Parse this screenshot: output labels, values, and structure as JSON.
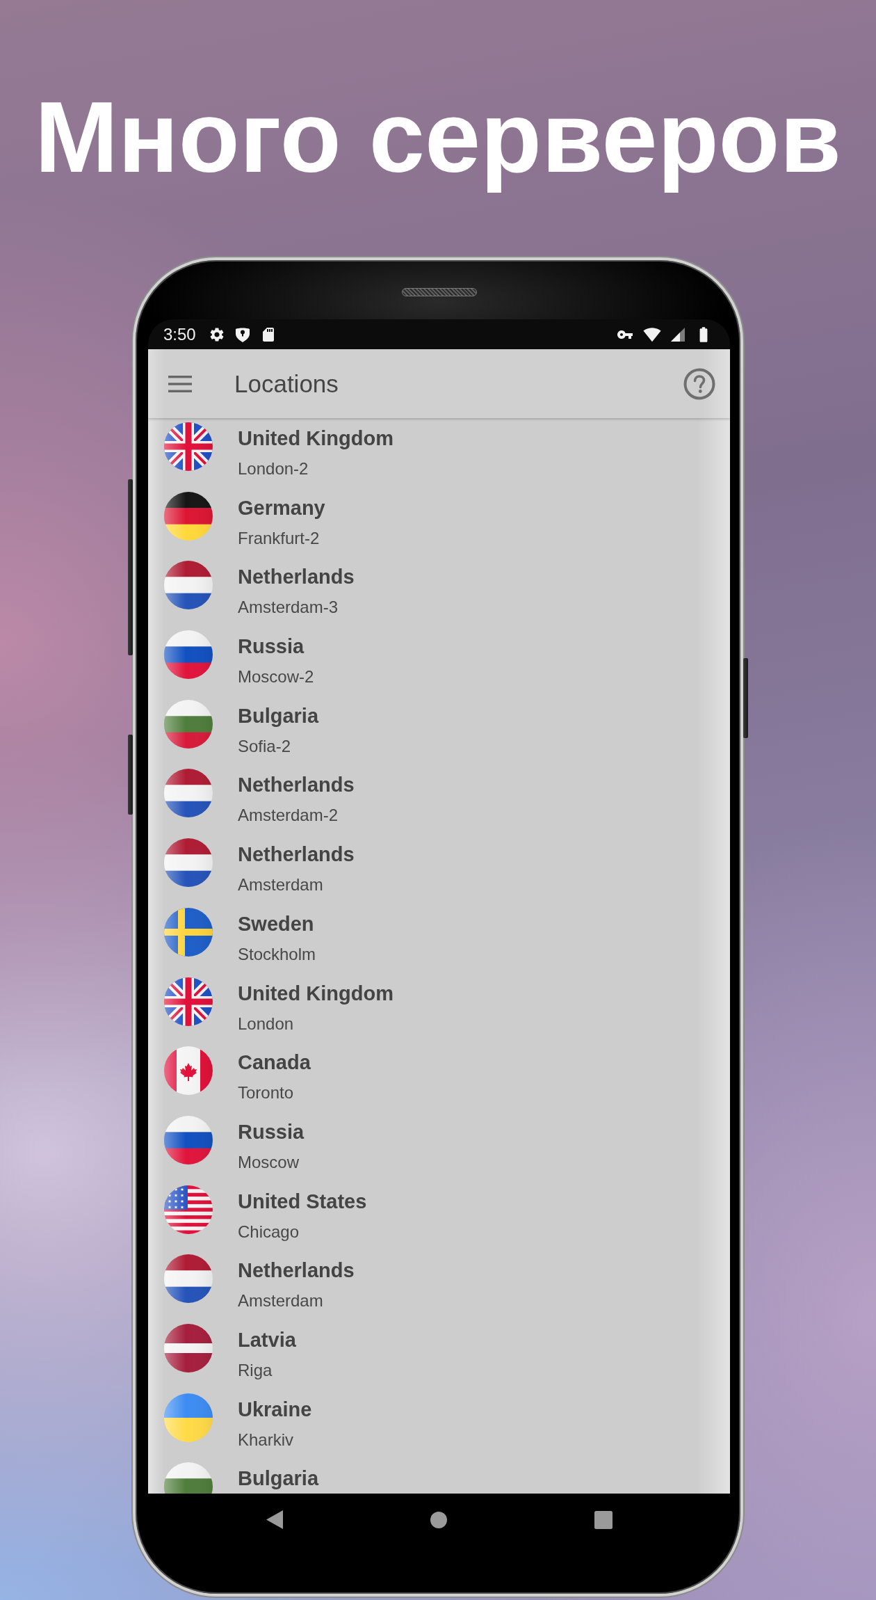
{
  "headline": "Много серверов",
  "status_bar": {
    "time": "3:50"
  },
  "app_bar": {
    "title": "Locations"
  },
  "locations": [
    {
      "kind": "uk",
      "country": "United Kingdom",
      "city": "London-2"
    },
    {
      "kind": "germany",
      "country": "Germany",
      "city": "Frankfurt-2"
    },
    {
      "kind": "netherlands",
      "country": "Netherlands",
      "city": "Amsterdam-3"
    },
    {
      "kind": "russia",
      "country": "Russia",
      "city": "Moscow-2"
    },
    {
      "kind": "bulgaria",
      "country": "Bulgaria",
      "city": "Sofia-2"
    },
    {
      "kind": "netherlands",
      "country": "Netherlands",
      "city": "Amsterdam-2"
    },
    {
      "kind": "netherlands",
      "country": "Netherlands",
      "city": "Amsterdam"
    },
    {
      "kind": "sweden",
      "country": "Sweden",
      "city": "Stockholm"
    },
    {
      "kind": "uk",
      "country": "United Kingdom",
      "city": "London"
    },
    {
      "kind": "canada",
      "country": "Canada",
      "city": "Toronto"
    },
    {
      "kind": "russia",
      "country": "Russia",
      "city": "Moscow"
    },
    {
      "kind": "usa",
      "country": "United States",
      "city": "Chicago"
    },
    {
      "kind": "netherlands",
      "country": "Netherlands",
      "city": "Amsterdam"
    },
    {
      "kind": "latvia",
      "country": "Latvia",
      "city": "Riga"
    },
    {
      "kind": "ukraine",
      "country": "Ukraine",
      "city": "Kharkiv"
    },
    {
      "kind": "bulgaria",
      "country": "Bulgaria"
    }
  ]
}
